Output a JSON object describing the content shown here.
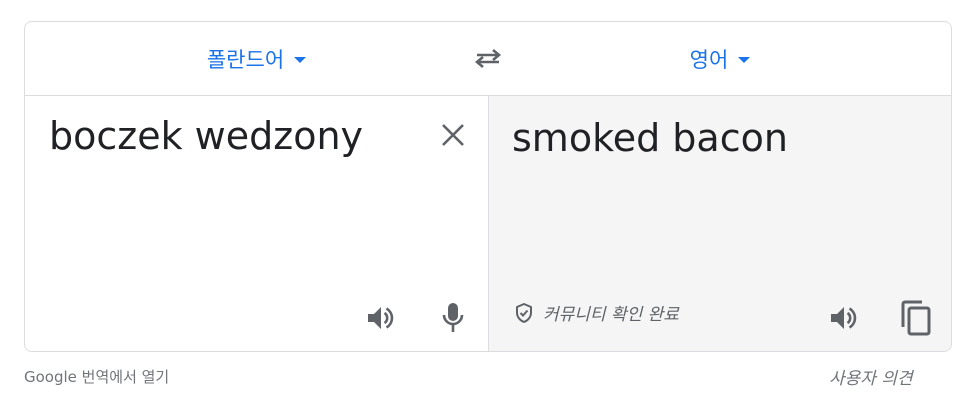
{
  "header": {
    "source_language": "폴란드어",
    "target_language": "영어"
  },
  "source": {
    "text": "boczek wedzony"
  },
  "target": {
    "text": "smoked bacon",
    "verified_label": "커뮤니티 확인 완료"
  },
  "footer": {
    "open_link": "Google 번역에서 열기",
    "feedback_link": "사용자 의견"
  },
  "icons": {
    "swap": "swap-languages-icon",
    "clear": "close-icon",
    "speaker": "speaker-icon",
    "mic": "microphone-icon",
    "shield": "shield-check-icon",
    "copy": "copy-icon"
  },
  "colors": {
    "accent": "#1a73e8",
    "icon": "#5f6368",
    "text": "#202124",
    "target_bg": "#f5f5f5",
    "border": "#dadce0"
  }
}
